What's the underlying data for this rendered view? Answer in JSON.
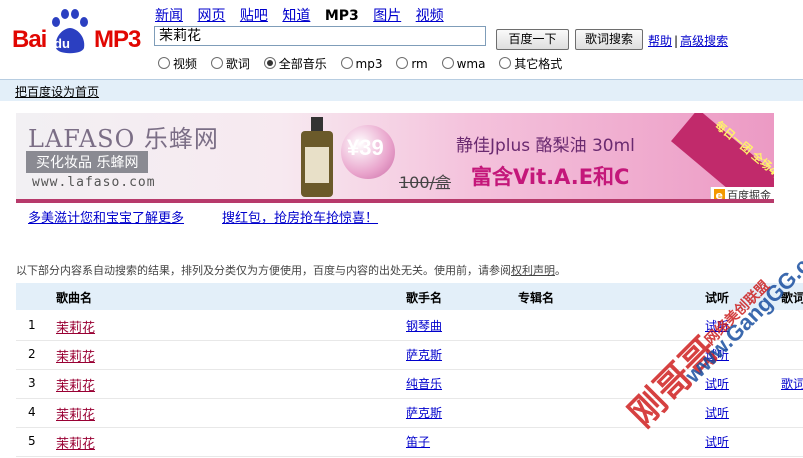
{
  "logo": {
    "bai": "Bai",
    "du": "du",
    "mp3": "MP3"
  },
  "nav": [
    {
      "label": "新闻",
      "active": false
    },
    {
      "label": "网页",
      "active": false
    },
    {
      "label": "贴吧",
      "active": false
    },
    {
      "label": "知道",
      "active": false
    },
    {
      "label": "MP3",
      "active": true
    },
    {
      "label": "图片",
      "active": false
    },
    {
      "label": "视频",
      "active": false
    }
  ],
  "search": {
    "value": "茉莉花",
    "button": "百度一下",
    "lyric_button": "歌词搜索"
  },
  "help_links": {
    "help": "帮助",
    "sep": "|",
    "advanced": "高级搜索"
  },
  "options": [
    {
      "label": "视频",
      "checked": false
    },
    {
      "label": "歌词",
      "checked": false
    },
    {
      "label": "全部音乐",
      "checked": true
    },
    {
      "label": "mp3",
      "checked": false
    },
    {
      "label": "rm",
      "checked": false
    },
    {
      "label": "wma",
      "checked": false
    },
    {
      "label": "其它格式",
      "checked": false
    }
  ],
  "homebar": {
    "link": "把百度设为首页"
  },
  "banner": {
    "brand": "LAFASO 乐蜂网",
    "tag": "买化妆品 乐蜂网",
    "url": "www.lafaso.com",
    "price": "¥39",
    "old_price": "100/盒",
    "product": "静佳Jplus 酪梨油 30ml",
    "feature": "富含Vit.A.E和C",
    "corner": "每日一团 全场4折起",
    "ad_label": "百度掘金",
    "ad_icon": "e"
  },
  "promos": [
    "多美滋计您和宝宝了解更多",
    "搜红包，抢房抢车抢惊喜！"
  ],
  "disclaimer": {
    "text": "以下部分内容系自动搜索的结果，排列及分类仅为方便使用，百度与内容的出处无关。使用前，请参阅",
    "link": "权利声明",
    "end": "。"
  },
  "table": {
    "headers": {
      "song": "歌曲名",
      "singer": "歌手名",
      "album": "专辑名",
      "listen": "试听",
      "lyric": "歌词"
    },
    "rows": [
      {
        "num": "1",
        "song": "茉莉花",
        "singer": "钢琴曲",
        "album": "",
        "listen": "试听",
        "lyric": ""
      },
      {
        "num": "2",
        "song": "茉莉花",
        "singer": "萨克斯",
        "album": "",
        "listen": "试听",
        "lyric": ""
      },
      {
        "num": "3",
        "song": "茉莉花",
        "singer": "纯音乐",
        "album": "",
        "listen": "试听",
        "lyric": "歌词"
      },
      {
        "num": "4",
        "song": "茉莉花",
        "singer": "萨克斯",
        "album": "",
        "listen": "试听",
        "lyric": ""
      },
      {
        "num": "5",
        "song": "茉莉花",
        "singer": "笛子",
        "album": "",
        "listen": "试听",
        "lyric": ""
      }
    ]
  },
  "watermark": {
    "big": "刚哥哥",
    "url": "www.GangGG.com",
    "small": "网络美创联盟"
  }
}
